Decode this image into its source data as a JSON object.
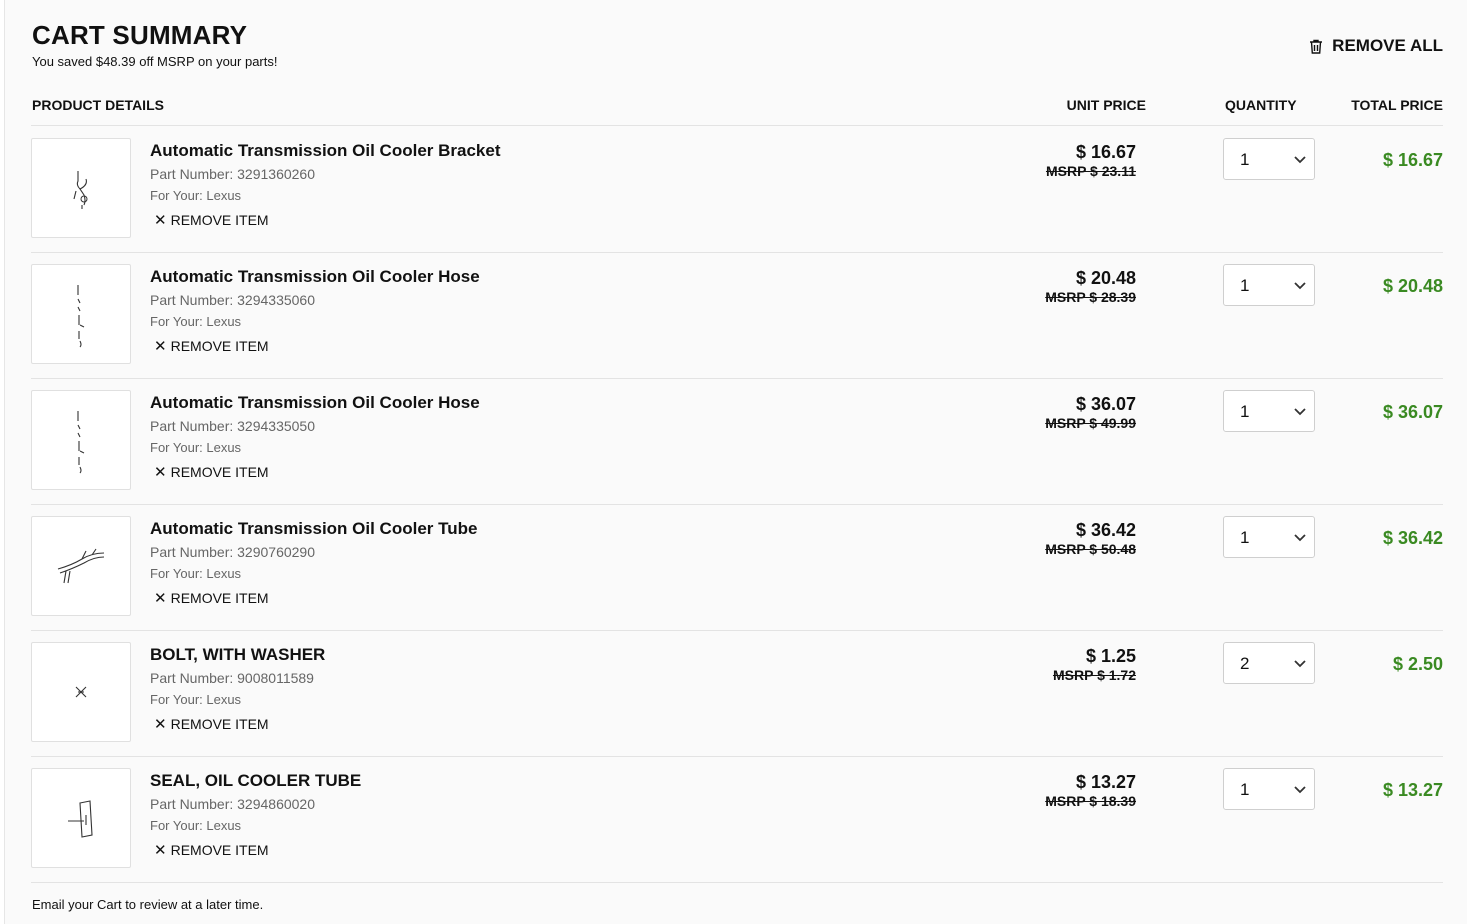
{
  "header": {
    "title": "CART SUMMARY",
    "savings_text": "You saved $48.39 off MSRP on your parts!",
    "remove_all_label": "REMOVE ALL"
  },
  "columns": {
    "product_details": "PRODUCT DETAILS",
    "unit_price": "UNIT PRICE",
    "quantity": "QUANTITY",
    "total_price": "TOTAL PRICE"
  },
  "items": [
    {
      "name": "Automatic Transmission Oil Cooler Bracket",
      "part_number": "Part Number: 3291360260",
      "for_your": "For Your: Lexus",
      "remove_label": "REMOVE ITEM",
      "unit_price": "$ 16.67",
      "msrp": "MSRP $ 23.11",
      "quantity": "1",
      "total_price": "$ 16.67",
      "image_icon": "bracket-part-icon"
    },
    {
      "name": "Automatic Transmission Oil Cooler Hose",
      "part_number": "Part Number: 3294335060",
      "for_your": "For Your: Lexus",
      "remove_label": "REMOVE ITEM",
      "unit_price": "$ 20.48",
      "msrp": "MSRP $ 28.39",
      "quantity": "1",
      "total_price": "$ 20.48",
      "image_icon": "hose-part-icon"
    },
    {
      "name": "Automatic Transmission Oil Cooler Hose",
      "part_number": "Part Number: 3294335050",
      "for_your": "For Your: Lexus",
      "remove_label": "REMOVE ITEM",
      "unit_price": "$ 36.07",
      "msrp": "MSRP $ 49.99",
      "quantity": "1",
      "total_price": "$ 36.07",
      "image_icon": "hose-part-icon"
    },
    {
      "name": "Automatic Transmission Oil Cooler Tube",
      "part_number": "Part Number: 3290760290",
      "for_your": "For Your: Lexus",
      "remove_label": "REMOVE ITEM",
      "unit_price": "$ 36.42",
      "msrp": "MSRP $ 50.48",
      "quantity": "1",
      "total_price": "$ 36.42",
      "image_icon": "tube-part-icon"
    },
    {
      "name": "BOLT, WITH WASHER",
      "part_number": "Part Number: 9008011589",
      "for_your": "For Your: Lexus",
      "remove_label": "REMOVE ITEM",
      "unit_price": "$ 1.25",
      "msrp": "MSRP $ 1.72",
      "quantity": "2",
      "total_price": "$ 2.50",
      "image_icon": "bolt-part-icon"
    },
    {
      "name": "SEAL, OIL COOLER TUBE",
      "part_number": "Part Number: 3294860020",
      "for_your": "For Your: Lexus",
      "remove_label": "REMOVE ITEM",
      "unit_price": "$ 13.27",
      "msrp": "MSRP $ 18.39",
      "quantity": "1",
      "total_price": "$ 13.27",
      "image_icon": "seal-part-icon"
    }
  ],
  "footer": {
    "email_text": "Email your Cart to review at a later time."
  },
  "colors": {
    "total_price": "#3a8a22",
    "panel_bg": "#fafafa",
    "divider": "#e3e3e3"
  }
}
